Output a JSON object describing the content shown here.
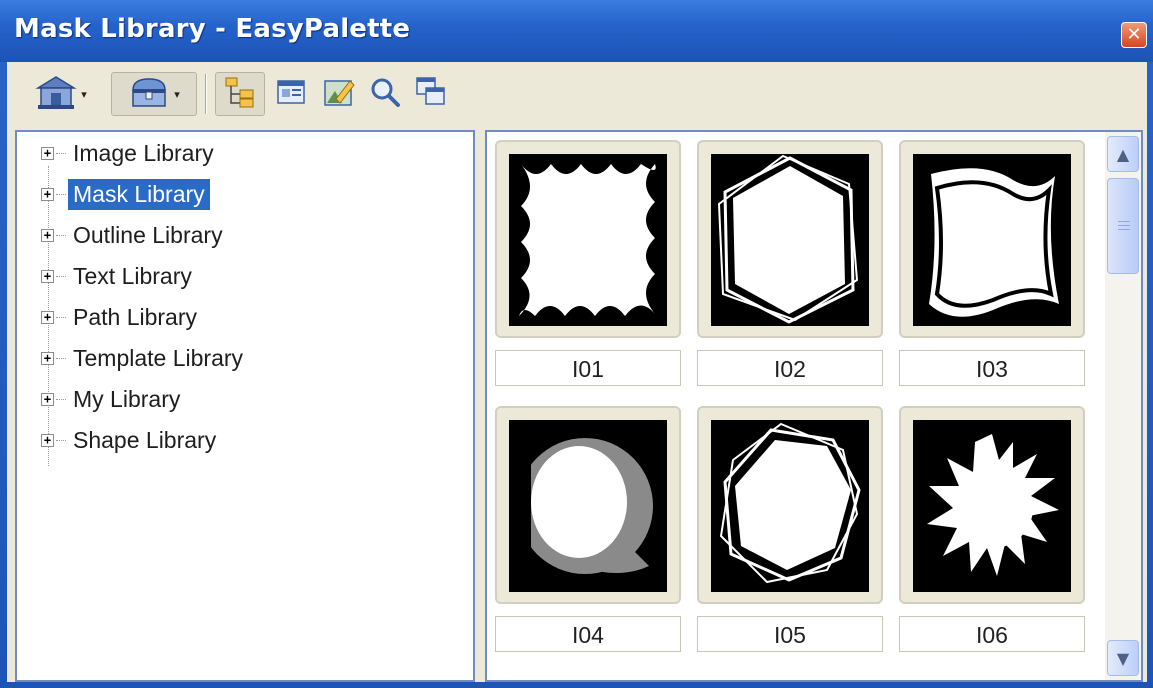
{
  "window": {
    "title": "Mask Library - EasyPalette",
    "close_glyph": "✕"
  },
  "toolbar": {
    "buttons": [
      {
        "icon": "library-home-icon",
        "has_dropdown": true
      },
      {
        "icon": "chest-icon",
        "has_dropdown": true,
        "pressed": true
      },
      {
        "icon": "tree-view-icon",
        "pressed": true
      },
      {
        "icon": "details-view-icon"
      },
      {
        "icon": "edit-image-icon"
      },
      {
        "icon": "magnifier-icon"
      },
      {
        "icon": "copy-windows-icon"
      }
    ],
    "dropdown_glyph": "▾"
  },
  "tree": {
    "items": [
      {
        "label": "Image Library",
        "expander": "+"
      },
      {
        "label": "Mask Library",
        "expander": "+",
        "selected": true
      },
      {
        "label": "Outline Library",
        "expander": "+"
      },
      {
        "label": "Text Library",
        "expander": "+"
      },
      {
        "label": "Path Library",
        "expander": "+"
      },
      {
        "label": "Template Library",
        "expander": "+"
      },
      {
        "label": "My Library",
        "expander": "+"
      },
      {
        "label": "Shape Library",
        "expander": "+"
      }
    ]
  },
  "thumbnails": {
    "items": [
      {
        "caption": "I01",
        "shape": "scalloped-square-mask"
      },
      {
        "caption": "I02",
        "shape": "hexagon-frame-mask"
      },
      {
        "caption": "I03",
        "shape": "wavy-square-mask"
      },
      {
        "caption": "I04",
        "shape": "brush-circle-mask"
      },
      {
        "caption": "I05",
        "shape": "heptagon-frame-mask"
      },
      {
        "caption": "I06",
        "shape": "splash-mask"
      }
    ]
  },
  "scrollbar": {
    "up_glyph": "▲",
    "down_glyph": "▼"
  },
  "colors": {
    "title_bar": "#2563cc",
    "selection": "#2a6bc8",
    "face": "#ece9d8",
    "close": "#d8431f"
  }
}
